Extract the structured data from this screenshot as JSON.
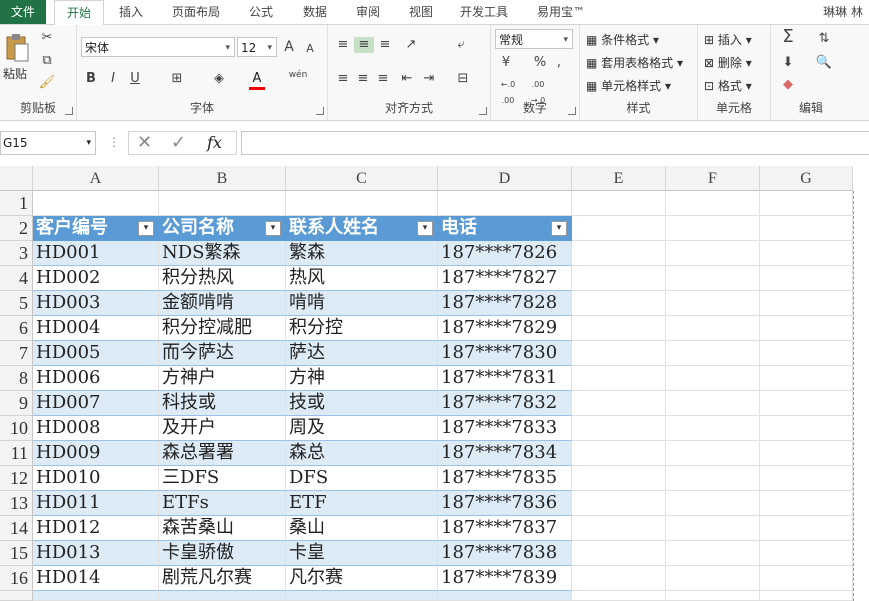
{
  "tabs": [
    "文件",
    "开始",
    "插入",
    "页面布局",
    "公式",
    "数据",
    "审阅",
    "视图",
    "开发工具",
    "易用宝™"
  ],
  "active_tab": "开始",
  "user_name": "琳琳 林",
  "ribbon": {
    "clipboard": {
      "paste": "粘贴",
      "label": "剪贴板"
    },
    "font": {
      "name": "宋体",
      "size": "12",
      "label": "字体",
      "bold": "B",
      "italic": "I",
      "underline": "U",
      "font_color": "A",
      "wen": "wén",
      "grow": "A",
      "shrink": "A"
    },
    "align": {
      "label": "对齐方式"
    },
    "number": {
      "format": "常规",
      "label": "数字",
      "percent": "%",
      "comma": ",",
      "inc": "←.0 .00",
      "dec": ".00 →.0"
    },
    "styles": {
      "cond": "条件格式",
      "table": "套用表格格式",
      "cell": "单元格样式",
      "label": "样式"
    },
    "cells": {
      "insert": "插入",
      "delete": "删除",
      "format": "格式",
      "label": "单元格"
    },
    "edit": {
      "label": "编辑",
      "sum": "Σ"
    }
  },
  "name_box": "G15",
  "formula": "",
  "fx": "fx",
  "columns": [
    "A",
    "B",
    "C",
    "D",
    "E",
    "F",
    "G"
  ],
  "table": {
    "headers": [
      "客户编号",
      "公司名称",
      "联系人姓名",
      "电话"
    ],
    "rows": [
      [
        "HD001",
        "NDS繁森",
        "繁森",
        "187****7826"
      ],
      [
        "HD002",
        "积分热风",
        "热风",
        "187****7827"
      ],
      [
        "HD003",
        "金额啃啃",
        "啃啃",
        "187****7828"
      ],
      [
        "HD004",
        "积分控减肥",
        "积分控",
        "187****7829"
      ],
      [
        "HD005",
        "而今萨达",
        "萨达",
        "187****7830"
      ],
      [
        "HD006",
        "方神户",
        "方神",
        "187****7831"
      ],
      [
        "HD007",
        "科技或",
        "技或",
        "187****7832"
      ],
      [
        "HD008",
        "及开户",
        "周及",
        "187****7833"
      ],
      [
        "HD009",
        "森总署署",
        "森总",
        "187****7834"
      ],
      [
        "HD010",
        "三DFS",
        "DFS",
        "187****7835"
      ],
      [
        "HD011",
        "ETFs",
        "ETF",
        "187****7836"
      ],
      [
        "HD012",
        "森苦桑山",
        "桑山",
        "187****7837"
      ],
      [
        "HD013",
        "卡皇骄傲",
        "卡皇",
        "187****7838"
      ],
      [
        "HD014",
        "剧荒凡尔赛",
        "凡尔赛",
        "187****7839"
      ]
    ]
  },
  "row_numbers": [
    "1",
    "2",
    "3",
    "4",
    "5",
    "6",
    "7",
    "8",
    "9",
    "10",
    "11",
    "12",
    "13",
    "14",
    "15",
    "16"
  ],
  "colors": {
    "accent": "#217346",
    "table_header": "#5b9bd5",
    "band": "#ddebf7"
  }
}
